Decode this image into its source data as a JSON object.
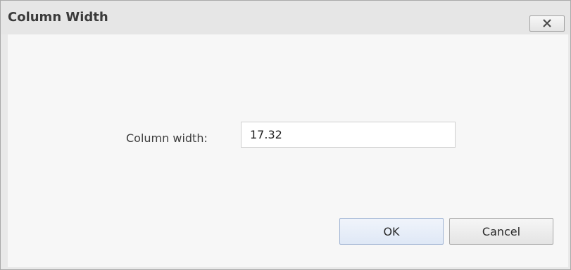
{
  "dialog": {
    "title": "Column Width",
    "close_icon": "close-icon"
  },
  "form": {
    "column_width_label": "Column width:",
    "column_width_value": "17.32"
  },
  "buttons": {
    "ok_label": "OK",
    "cancel_label": "Cancel"
  }
}
